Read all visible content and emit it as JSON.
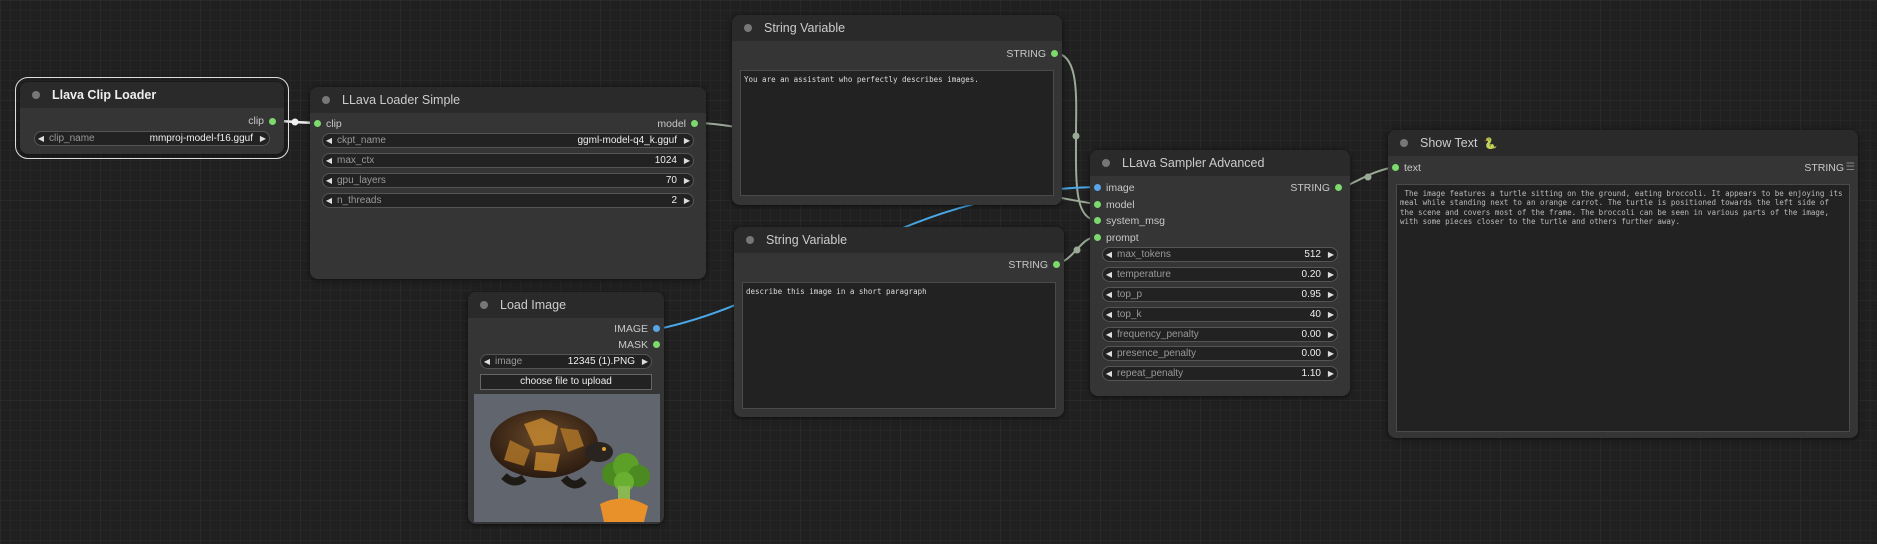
{
  "nodes": {
    "clip_loader": {
      "title": "Llava Clip Loader",
      "output": "clip",
      "widgets": [
        {
          "name": "clip_name",
          "value": "mmproj-model-f16.gguf"
        }
      ]
    },
    "loader_simple": {
      "title": "LLava Loader Simple",
      "input": "clip",
      "output": "model",
      "widgets": [
        {
          "name": "ckpt_name",
          "value": "ggml-model-q4_k.gguf"
        },
        {
          "name": "max_ctx",
          "value": "1024"
        },
        {
          "name": "gpu_layers",
          "value": "70"
        },
        {
          "name": "n_threads",
          "value": "2"
        }
      ]
    },
    "string_var_1": {
      "title": "String Variable",
      "output": "STRING",
      "text": "You are an assistant who perfectly describes images."
    },
    "string_var_2": {
      "title": "String Variable",
      "output": "STRING",
      "text": "describe this image in a short paragraph"
    },
    "load_image": {
      "title": "Load Image",
      "outputs": [
        "IMAGE",
        "MASK"
      ],
      "widget": {
        "name": "image",
        "value": "12345 (1).PNG"
      },
      "upload_label": "choose file to upload"
    },
    "sampler": {
      "title": "LLava Sampler Advanced",
      "inputs": [
        "image",
        "model",
        "system_msg",
        "prompt"
      ],
      "output": "STRING",
      "widgets": [
        {
          "name": "max_tokens",
          "value": "512"
        },
        {
          "name": "temperature",
          "value": "0.20"
        },
        {
          "name": "top_p",
          "value": "0.95"
        },
        {
          "name": "top_k",
          "value": "40"
        },
        {
          "name": "frequency_penalty",
          "value": "0.00"
        },
        {
          "name": "presence_penalty",
          "value": "0.00"
        },
        {
          "name": "repeat_penalty",
          "value": "1.10"
        }
      ]
    },
    "show_text": {
      "title": "Show Text",
      "title_icon": "python-snake-icon",
      "input": "text",
      "output": "STRING",
      "output_icon": "list-icon",
      "text": " The image features a turtle sitting on the ground, eating broccoli. It appears to be enjoying its meal while standing next to an orange carrot. The turtle is positioned towards the left side of the scene and covers most of the frame. The broccoli can be seen in various parts of the image, with some pieces closer to the turtle and others further away."
    }
  },
  "colors": {
    "canvas": "#202020",
    "node_body": "#353535",
    "node_title": "#2a2a2a",
    "slot_green": "#7cda6c",
    "slot_blue": "#5aa4e8",
    "wire_light": "#9aaa96",
    "wire_blue": "#4aa8e8"
  }
}
